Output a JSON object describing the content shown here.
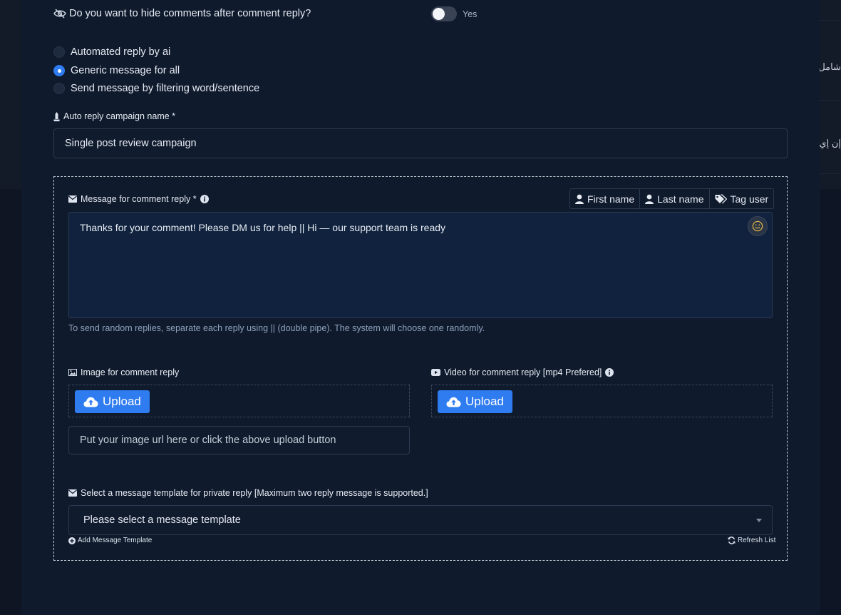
{
  "background": {
    "right_peek": [
      "شامل",
      "إن إي"
    ]
  },
  "hide_comments": {
    "question": "Do you want to hide comments after comment reply?",
    "toggle_label": "Yes",
    "enabled": false
  },
  "reply_modes": [
    {
      "label": "Automated reply by ai",
      "selected": false
    },
    {
      "label": "Generic message for all",
      "selected": true
    },
    {
      "label": "Send message by filtering word/sentence",
      "selected": false
    }
  ],
  "campaign": {
    "label": "Auto reply campaign name *",
    "value": "Single post review campaign"
  },
  "message": {
    "label": "Message for comment reply *",
    "chips": [
      "First name",
      "Last name",
      "Tag user"
    ],
    "value": "Thanks for your comment! Please DM us for help || Hi — our support team is ready",
    "hint": "To send random replies, separate each reply using || (double pipe). The system will choose one randomly."
  },
  "image_reply": {
    "label": "Image for comment reply",
    "upload_label": "Upload",
    "url_placeholder": "Put your image url here or click the above upload button"
  },
  "video_reply": {
    "label": "Video for comment reply [mp4 Prefered]",
    "upload_label": "Upload"
  },
  "template": {
    "label": "Select a message template for private reply [Maximum two reply message is supported.]",
    "selected": "Please select a message template",
    "add_link": "Add Message Template",
    "refresh_link": "Refresh List"
  },
  "colors": {
    "accent": "#2f7cf0",
    "panel": "#0f1a2c",
    "textarea": "#10223d"
  }
}
